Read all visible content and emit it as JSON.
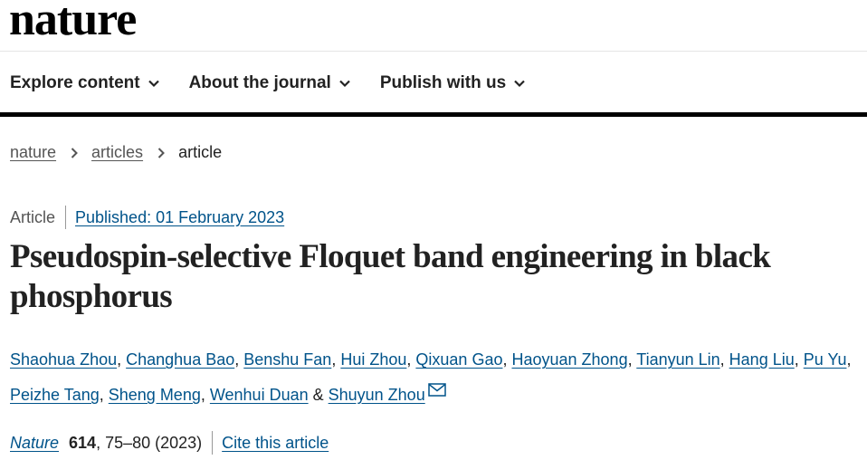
{
  "header": {
    "logo": "nature"
  },
  "nav": {
    "items": [
      {
        "label": "Explore content"
      },
      {
        "label": "About the journal"
      },
      {
        "label": "Publish with us"
      }
    ]
  },
  "breadcrumb": {
    "items": [
      "nature",
      "articles"
    ],
    "current": "article"
  },
  "article": {
    "type": "Article",
    "published": "Published: 01 February 2023",
    "title": "Pseudospin-selective Floquet band engineering in black phosphorus",
    "authors": [
      "Shaohua Zhou",
      "Changhua Bao",
      "Benshu Fan",
      "Hui Zhou",
      "Qixuan Gao",
      "Haoyuan Zhong",
      "Tianyun Lin",
      "Hang Liu",
      "Pu Yu",
      "Peizhe Tang",
      "Sheng Meng",
      "Wenhui Duan",
      "Shuyun Zhou"
    ],
    "author_separator": ", ",
    "author_conjunction": " & "
  },
  "citation": {
    "journal": "Nature",
    "volume": "614",
    "pages": ", 75–80 (2023)",
    "cite_label": "Cite this article"
  },
  "icons": {
    "nav_dropdown": "chevron-down-icon",
    "breadcrumb_separator": "chevron-right-icon",
    "corresponding_author": "envelope-icon"
  },
  "colors": {
    "link": "#00538a",
    "text": "#222222",
    "muted": "#555555"
  }
}
